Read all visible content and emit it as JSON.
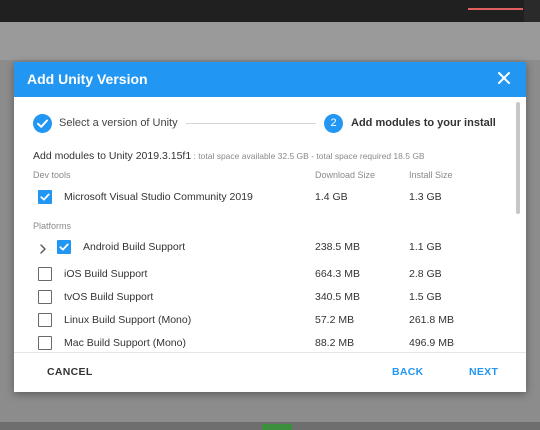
{
  "dialog": {
    "title": "Add Unity Version",
    "close_icon": "close-icon"
  },
  "stepper": {
    "step1": {
      "icon": "check-icon",
      "label": "Select a version of Unity"
    },
    "step2": {
      "number": "2",
      "label": "Add modules to your install"
    }
  },
  "summary": {
    "main": "Add modules to Unity 2019.3.15f1",
    "sub": " : total space available 32.5 GB - total space required 18.5 GB"
  },
  "columns": {
    "download": "Download Size",
    "install": "Install Size"
  },
  "sections": {
    "dev_tools": "Dev tools",
    "platforms": "Platforms"
  },
  "modules": {
    "vs": {
      "label": "Microsoft Visual Studio Community 2019",
      "download": "1.4 GB",
      "install": "1.3 GB",
      "checked": true
    },
    "android": {
      "label": "Android Build Support",
      "download": "238.5 MB",
      "install": "1.1 GB",
      "checked": true
    },
    "ios": {
      "label": "iOS Build Support",
      "download": "664.3 MB",
      "install": "2.8 GB",
      "checked": false
    },
    "tvos": {
      "label": "tvOS Build Support",
      "download": "340.5 MB",
      "install": "1.5 GB",
      "checked": false
    },
    "linux": {
      "label": "Linux Build Support (Mono)",
      "download": "57.2 MB",
      "install": "261.8 MB",
      "checked": false
    },
    "mac": {
      "label": "Mac Build Support (Mono)",
      "download": "88.2 MB",
      "install": "496.9 MB",
      "checked": false
    }
  },
  "footer": {
    "cancel": "CANCEL",
    "back": "BACK",
    "next": "NEXT"
  },
  "colors": {
    "accent": "#2196f3",
    "header_text": "#ffffff"
  }
}
